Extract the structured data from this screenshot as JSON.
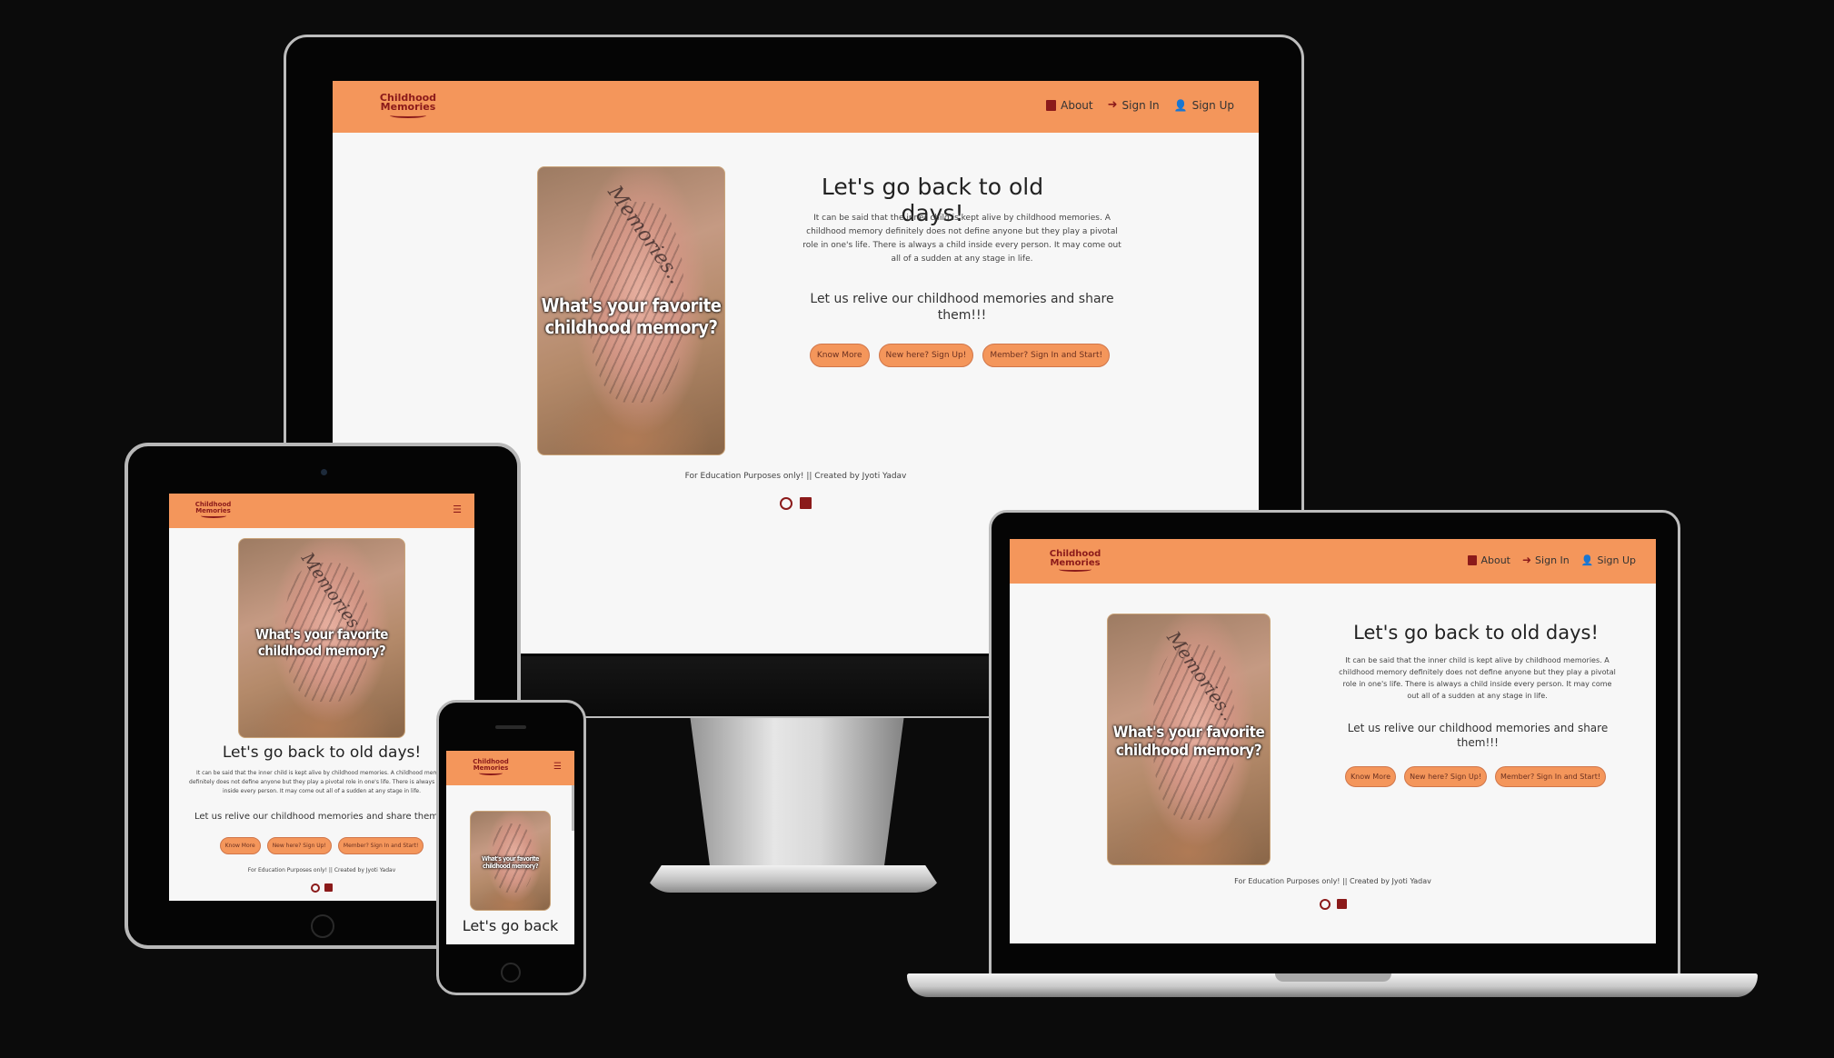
{
  "site": {
    "logo_line1": "Childhood",
    "logo_line2": "Memories",
    "nav": {
      "about": "About",
      "sign_in": "Sign In",
      "sign_up": "Sign Up"
    },
    "hero": {
      "image_caption_line1": "What's your favorite",
      "image_caption_line2": "childhood memory?",
      "image_scribble": "Memories..",
      "title": "Let's go back to old days!",
      "paragraph": "It can be said that the inner child is kept alive by childhood memories. A childhood memory definitely does not define anyone but they play a pivotal role in one's life. There is always a child inside every person. It may come out all of a sudden at any stage in life.",
      "subtitle": "Let us relive our childhood memories and share them!!!",
      "buttons": [
        "Know More",
        "New here? Sign Up!",
        "Member? Sign In and Start!"
      ]
    },
    "footer": "For Education Purposes only! || Created by Jyoti Yadav",
    "phone_title": "Let's go back"
  },
  "icons": {
    "about": "note-icon",
    "sign_in": "sign-in-icon",
    "sign_up": "user-plus-icon",
    "menu": "hamburger-icon",
    "github": "github-icon",
    "linkedin": "linkedin-icon"
  },
  "colors": {
    "navbar": "#f4965b",
    "accent": "#8b1a1a",
    "page_bg": "#f7f7f7",
    "backdrop": "#0b0b0b"
  }
}
